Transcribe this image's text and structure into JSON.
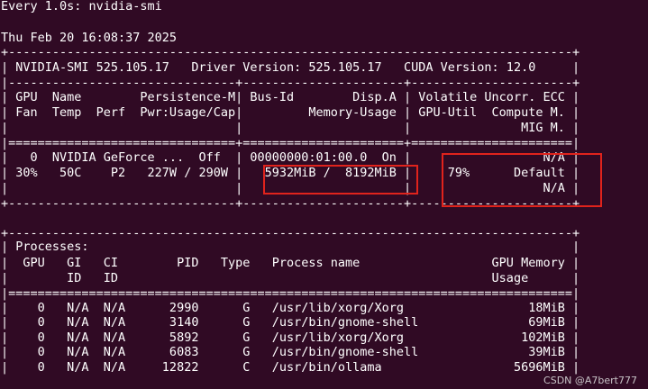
{
  "window": {
    "header": "Every 1.0s: nvidia-smi",
    "timestamp": "Thu Feb 20 16:08:37 2025"
  },
  "nvidia_smi": {
    "version": "525.105.17",
    "driver_version": "525.105.17",
    "cuda_version": "12.0",
    "lines": [
      "+-----------------------------------------------------------------------------+",
      "| NVIDIA-SMI 525.105.17   Driver Version: 525.105.17   CUDA Version: 12.0     |",
      "|-------------------------------+----------------------+----------------------+",
      "| GPU  Name        Persistence-M| Bus-Id        Disp.A | Volatile Uncorr. ECC |",
      "| Fan  Temp  Perf  Pwr:Usage/Cap|         Memory-Usage | GPU-Util  Compute M. |",
      "|                               |                      |               MIG M. |",
      "|===============================+======================+======================|",
      "|   0  NVIDIA GeForce ...  Off  | 00000000:01:00.0  On |                  N/A |",
      "| 30%   50C    P2   227W / 290W |   5932MiB /  8192MiB |     79%      Default |",
      "|                               |                      |                  N/A |",
      "+-------------------------------+----------------------+----------------------+",
      "",
      "+-----------------------------------------------------------------------------+",
      "| Processes:                                                                  |",
      "|  GPU   GI   CI        PID   Type   Process name                  GPU Memory |",
      "|        ID   ID                                                   Usage      |",
      "|=============================================================================|",
      "|    0   N/A  N/A      2990      G   /usr/lib/xorg/Xorg                 18MiB |",
      "|    0   N/A  N/A      3140      G   /usr/bin/gnome-shell               69MiB |",
      "|    0   N/A  N/A      5892      G   /usr/lib/xorg/Xorg                102MiB |",
      "|    0   N/A  N/A      6083      G   /usr/bin/gnome-shell               39MiB |",
      "|    0   N/A  N/A     12822      C   /usr/bin/ollama                  5696MiB |"
    ],
    "gpu": {
      "index": "0",
      "name": "NVIDIA GeForce ...",
      "persistence_mode": "Off",
      "bus_id": "00000000:01:00.0",
      "display_active": "On",
      "ecc": "N/A",
      "fan": "30%",
      "temp": "50C",
      "perf": "P2",
      "power_usage": "227W",
      "power_cap": "290W",
      "memory_used": "5932MiB",
      "memory_total": "8192MiB",
      "gpu_util": "79%",
      "compute_mode": "Default",
      "mig_mode": "N/A"
    },
    "processes": [
      {
        "gpu": "0",
        "gi": "N/A",
        "ci": "N/A",
        "pid": "2990",
        "type": "G",
        "name": "/usr/lib/xorg/Xorg",
        "memory": "18MiB"
      },
      {
        "gpu": "0",
        "gi": "N/A",
        "ci": "N/A",
        "pid": "3140",
        "type": "G",
        "name": "/usr/bin/gnome-shell",
        "memory": "69MiB"
      },
      {
        "gpu": "0",
        "gi": "N/A",
        "ci": "N/A",
        "pid": "5892",
        "type": "G",
        "name": "/usr/lib/xorg/Xorg",
        "memory": "102MiB"
      },
      {
        "gpu": "0",
        "gi": "N/A",
        "ci": "N/A",
        "pid": "6083",
        "type": "G",
        "name": "/usr/bin/gnome-shell",
        "memory": "39MiB"
      },
      {
        "gpu": "0",
        "gi": "N/A",
        "ci": "N/A",
        "pid": "12822",
        "type": "C",
        "name": "/usr/bin/ollama",
        "memory": "5696MiB"
      }
    ]
  },
  "watermark": "CSDN @A7bert777",
  "colors": {
    "background": "#300a24",
    "text": "#ffffff",
    "highlight_box": "#e0231c"
  }
}
